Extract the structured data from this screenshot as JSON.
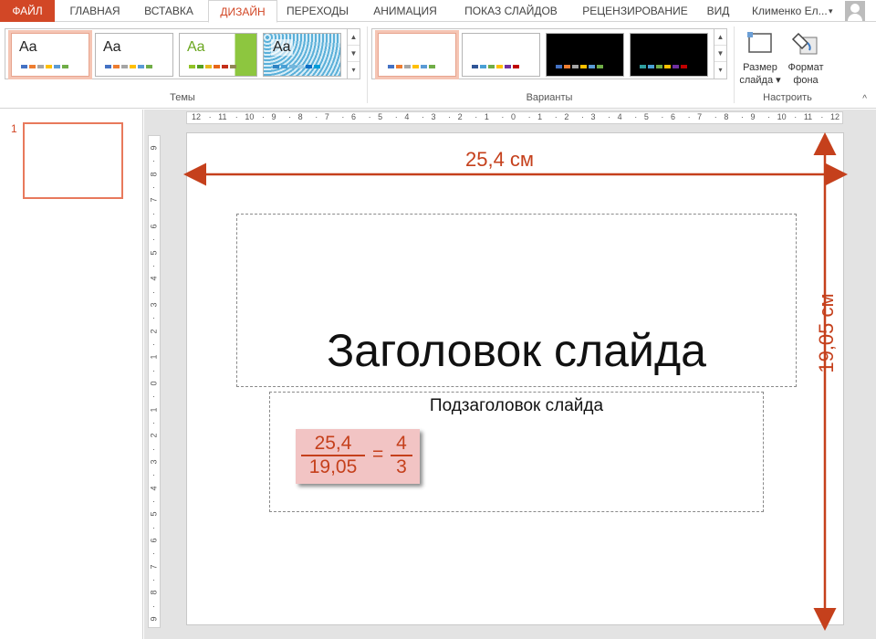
{
  "tabs": [
    {
      "label": "ФАЙЛ"
    },
    {
      "label": "ГЛАВНАЯ"
    },
    {
      "label": "ВСТАВКА"
    },
    {
      "label": "ДИЗАЙН"
    },
    {
      "label": "ПЕРЕХОДЫ"
    },
    {
      "label": "АНИМАЦИЯ"
    },
    {
      "label": "ПОКАЗ СЛАЙДОВ"
    },
    {
      "label": "РЕЦЕНЗИРОВАНИЕ"
    },
    {
      "label": "ВИД"
    }
  ],
  "active_tab": "ДИЗАЙН",
  "user": {
    "name": "Клименко Ел...",
    "menu_arrow": "▾"
  },
  "ribbon": {
    "themes_label": "Темы",
    "variants_label": "Варианты",
    "customize_label": "Настроить",
    "theme_thumb_text": "Aa",
    "slide_size": {
      "line1": "Размер",
      "line2": "слайда ▾"
    },
    "format_bg": {
      "line1": "Формат",
      "line2": "фона"
    },
    "scroll": {
      "up": "▲",
      "down": "▼",
      "more": "▾"
    },
    "collapse": "^"
  },
  "slides_pane": {
    "number": "1"
  },
  "rulers": {
    "horizontal": [
      "12",
      "11",
      "10",
      "9",
      "8",
      "7",
      "6",
      "5",
      "4",
      "3",
      "2",
      "1",
      "0",
      "1",
      "2",
      "3",
      "4",
      "5",
      "6",
      "7",
      "8",
      "9",
      "10",
      "11",
      "12"
    ],
    "vertical": [
      "9",
      "8",
      "7",
      "6",
      "5",
      "4",
      "3",
      "2",
      "1",
      "0",
      "1",
      "2",
      "3",
      "4",
      "5",
      "6",
      "7",
      "8",
      "9"
    ]
  },
  "slide": {
    "title": "Заголовок слайда",
    "subtitle": "Подзаголовок слайда",
    "width_label": "25,4 см",
    "height_label": "19,05 см",
    "formula": {
      "num1": "25,4",
      "den1": "19,05",
      "eq": "=",
      "num2": "4",
      "den2": "3"
    }
  },
  "colors": {
    "accent": "#d24726",
    "annotation": "#c5401c",
    "formula_bg": "#f2c4c4"
  }
}
